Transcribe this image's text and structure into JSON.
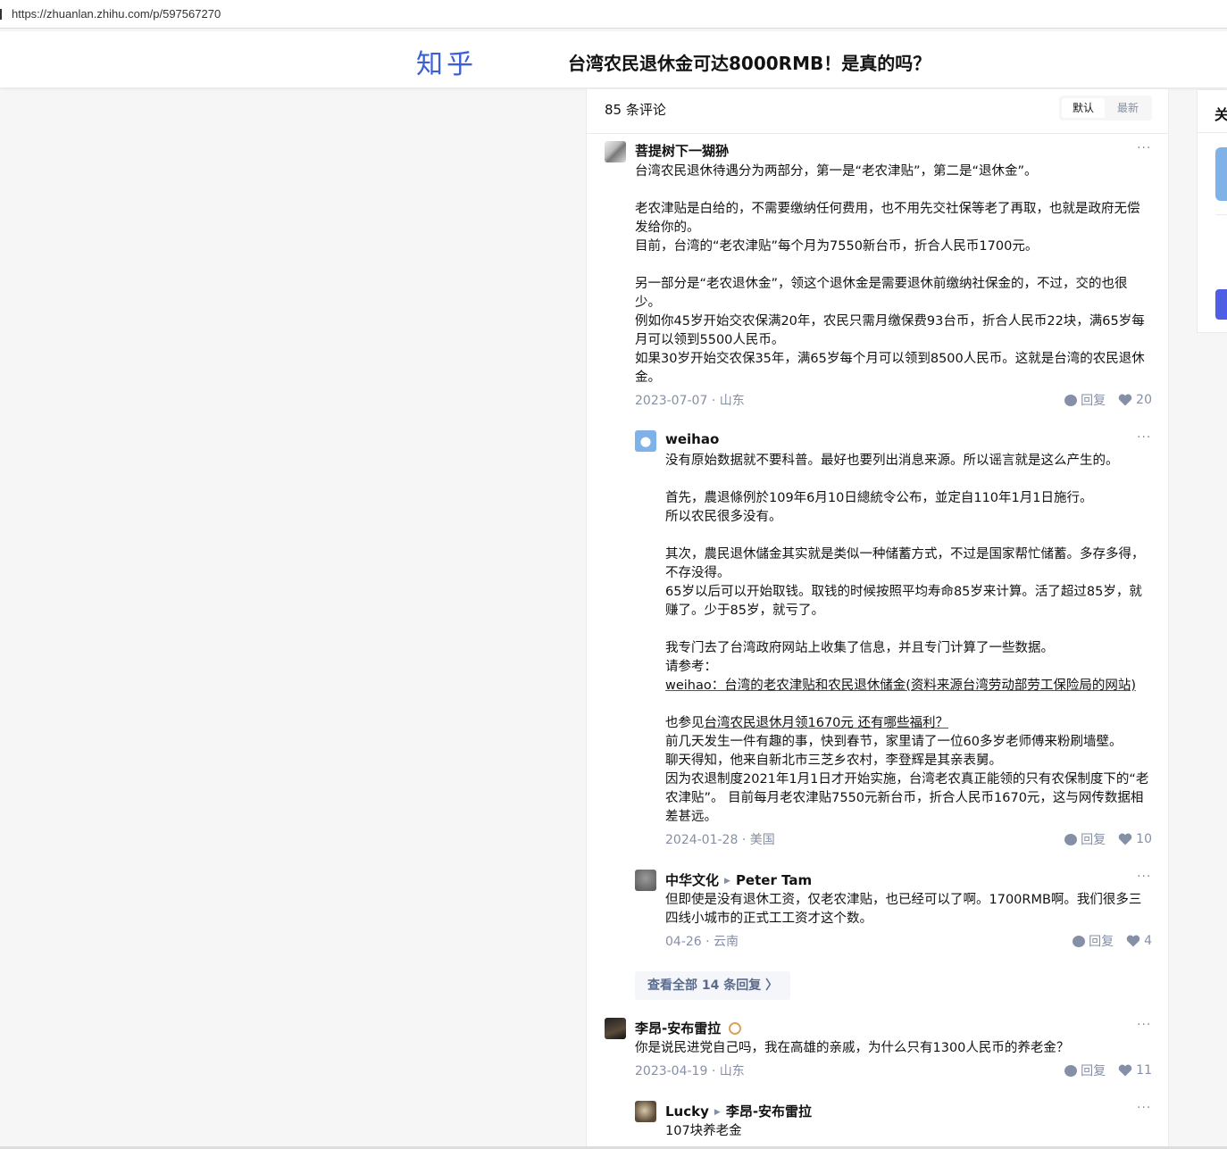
{
  "browser": {
    "url": "https://zhuanlan.zhihu.com/p/597567270"
  },
  "header": {
    "logo": "知乎",
    "article_title": "台湾农民退休金可达8000RMB！是真的吗？"
  },
  "comments_panel": {
    "count_label": "85 条评论",
    "sort_options": [
      "默认",
      "最新"
    ],
    "selected_sort": "默认",
    "view_all_label": "查看全部 14 条回复  〉"
  },
  "comments": [
    {
      "author": "菩提树下一猢狲",
      "lines": [
        "台湾农民退休待遇分为两部分，第一是“老农津贴”，第二是“退休金”。",
        "",
        "老农津贴是白给的，不需要缴纳任何费用，也不用先交社保等老了再取，也就是政府无偿发给你的。",
        "目前，台湾的“老农津贴”每个月为7550新台币，折合人民币1700元。",
        "",
        "另一部分是“老农退休金”，领这个退休金是需要退休前缴纳社保金的，不过，交的也很少。",
        "例如你45岁开始交农保满20年，农民只需月缴保费93台币，折合人民币22块，满65岁每月可以领到5500人民币。",
        "如果30岁开始交农保35年，满65岁每个月可以领到8500人民币。这就是台湾的农民退休金。"
      ],
      "date": "2023-07-07",
      "location": "山东",
      "reply_label": "回复",
      "likes": "20"
    },
    {
      "author": "weihao",
      "lines": [
        "没有原始数据就不要科普。最好也要列出消息来源。所以谣言就是这么产生的。",
        "",
        "首先，農退條例於109年6月10日總統令公布，並定自110年1月1日施行。",
        "所以农民很多没有。",
        "",
        "其次，農民退休儲金其实就是类似一种储蓄方式，不过是国家帮忙储蓄。多存多得，不存没得。",
        "65岁以后可以开始取钱。取钱的时候按照平均寿命85岁来计算。活了超过85岁，就赚了。少于85岁，就亏了。",
        "",
        "我专门去了台湾政府网站上收集了信息，并且专门计算了一些数据。",
        "请参考："
      ],
      "link1": "weihao：台湾的老农津贴和农民退休储金(资料来源台湾劳动部劳工保险局的网站)",
      "see_also_prefix": "也参见",
      "link2": "台湾农民退休月领1670元 还有哪些福利？ ",
      "lines2": [
        "前几天发生一件有趣的事，快到春节，家里请了一位60多岁老师傅来粉刷墙壁。",
        "聊天得知，他来自新北市三芝乡农村，李登辉是其亲表舅。",
        "因为农退制度2021年1月1日才开始实施，台湾老农真正能领的只有农保制度下的“老农津贴”。 目前每月老农津贴7550元新台币，折合人民币1670元，这与网传数据相差甚远。"
      ],
      "date": "2024-01-28",
      "location": "美国",
      "reply_label": "回复",
      "likes": "10"
    },
    {
      "author": "中华文化",
      "reply_to": "Peter Tam",
      "lines": [
        "但即使是没有退休工资，仅老农津贴，也已经可以了啊。1700RMB啊。我们很多三四线小城市的正式工工资才这个数。"
      ],
      "date": "04-26",
      "location": "云南",
      "reply_label": "回复",
      "likes": "4"
    },
    {
      "author": "李昂-安布雷拉",
      "lines": [
        "你是说民进党自己吗，我在高雄的亲戚，为什么只有1300人民币的养老金？"
      ],
      "date": "2023-04-19",
      "location": "山东",
      "reply_label": "回复",
      "likes": "11"
    },
    {
      "author": "Lucky",
      "reply_to": "李昂-安布雷拉",
      "lines": [
        "107块养老金"
      ]
    }
  ],
  "sidebar": {
    "title_fragment": "关"
  },
  "colors": {
    "brand": "#1772f6",
    "meta": "#8590a6",
    "like_heart": "#8590a6"
  }
}
